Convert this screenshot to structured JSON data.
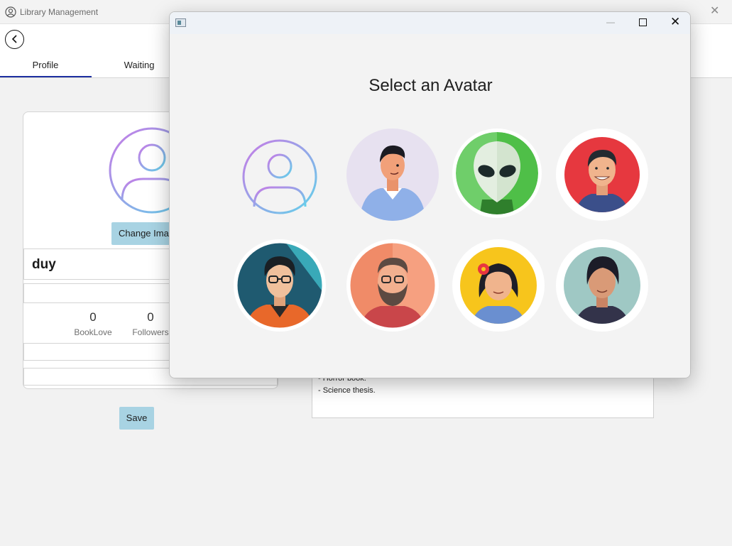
{
  "window": {
    "title": "Library Management",
    "close_glyph": "✕"
  },
  "tabs": [
    {
      "label": "Profile",
      "active": true
    },
    {
      "label": "Waiting",
      "active": false
    }
  ],
  "profile": {
    "change_image_label": "Change Image",
    "username": "duy",
    "stats": [
      {
        "value": "0",
        "label": "BookLove"
      },
      {
        "value": "0",
        "label": "Followers"
      }
    ],
    "save_label": "Save"
  },
  "description": {
    "lines": [
      "- Horror book.",
      "- Science thesis."
    ]
  },
  "dialog": {
    "min_glyph": "—",
    "close_glyph": "✕",
    "heading": "Select an Avatar",
    "avatars": [
      {
        "name": "default-user-icon"
      },
      {
        "name": "man-casual-avatar"
      },
      {
        "name": "alien-avatar"
      },
      {
        "name": "smiling-man-avatar"
      },
      {
        "name": "glasses-man-avatar"
      },
      {
        "name": "bearded-man-avatar"
      },
      {
        "name": "woman-flower-avatar"
      },
      {
        "name": "woman-short-hair-avatar"
      }
    ]
  },
  "colors": {
    "accent": "#1c2ea0",
    "button_bg": "#a8d3e3"
  }
}
